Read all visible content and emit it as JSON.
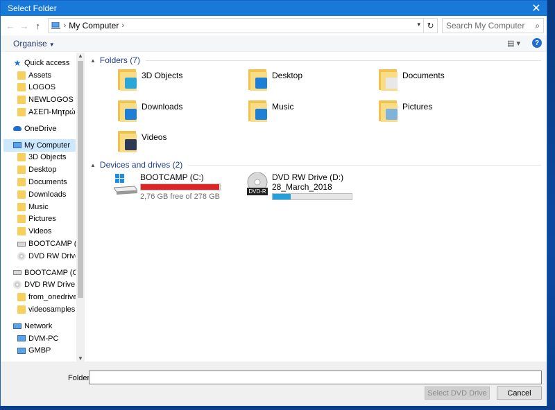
{
  "window": {
    "title": "Select Folder"
  },
  "address": {
    "location": "My Computer",
    "search_placeholder": "Search My Computer"
  },
  "toolbar": {
    "organise": "Organise"
  },
  "sidebar": {
    "items": [
      {
        "label": "Quick access",
        "icon": "star-icon",
        "level": 0
      },
      {
        "label": "Assets",
        "icon": "folder-icon",
        "level": 1
      },
      {
        "label": "LOGOS",
        "icon": "folder-icon",
        "level": 1
      },
      {
        "label": "NEWLOGOS",
        "icon": "folder-icon",
        "level": 1
      },
      {
        "label": "ΑΣΕΠ-Μητρώο_",
        "icon": "folder-icon",
        "level": 1
      },
      {
        "label": "OneDrive",
        "icon": "cloud-icon",
        "level": 0
      },
      {
        "label": "My Computer",
        "icon": "computer-icon",
        "level": 0,
        "selected": true
      },
      {
        "label": "3D Objects",
        "icon": "folder-icon",
        "level": 1
      },
      {
        "label": "Desktop",
        "icon": "folder-icon",
        "level": 1
      },
      {
        "label": "Documents",
        "icon": "folder-icon",
        "level": 1
      },
      {
        "label": "Downloads",
        "icon": "folder-icon",
        "level": 1
      },
      {
        "label": "Music",
        "icon": "folder-icon",
        "level": 1
      },
      {
        "label": "Pictures",
        "icon": "folder-icon",
        "level": 1
      },
      {
        "label": "Videos",
        "icon": "folder-icon",
        "level": 1
      },
      {
        "label": "BOOTCAMP (C:)",
        "icon": "drive-icon",
        "level": 1
      },
      {
        "label": "DVD RW Drive (D",
        "icon": "dvd-icon",
        "level": 1
      },
      {
        "label": "BOOTCAMP (C:)",
        "icon": "drive-icon",
        "level": 0
      },
      {
        "label": "DVD RW Drive (D:",
        "icon": "dvd-icon",
        "level": 0
      },
      {
        "label": "from_onedrive",
        "icon": "folder-icon",
        "level": 1
      },
      {
        "label": "videosamples",
        "icon": "folder-icon",
        "level": 1
      },
      {
        "label": "Network",
        "icon": "network-icon",
        "level": 0
      },
      {
        "label": "DVM-PC",
        "icon": "computer-icon",
        "level": 1
      },
      {
        "label": "GMBP",
        "icon": "computer-icon",
        "level": 1
      }
    ]
  },
  "folders": {
    "heading": "Folders (7)",
    "items": [
      {
        "label": "3D Objects",
        "icon": "3d-objects-folder-icon",
        "badge": "#2aa7d8"
      },
      {
        "label": "Desktop",
        "icon": "desktop-folder-icon",
        "badge": "#1e7fd6"
      },
      {
        "label": "Documents",
        "icon": "documents-folder-icon",
        "badge": "#e8e8e8"
      },
      {
        "label": "Downloads",
        "icon": "downloads-folder-icon",
        "badge": "#1e7fd6"
      },
      {
        "label": "Music",
        "icon": "music-folder-icon",
        "badge": "#1e7fd6"
      },
      {
        "label": "Pictures",
        "icon": "pictures-folder-icon",
        "badge": "#7fb3d9"
      },
      {
        "label": "Videos",
        "icon": "videos-folder-icon",
        "badge": "#2d3a55"
      }
    ]
  },
  "drives": {
    "heading": "Devices and drives (2)",
    "items": [
      {
        "label": "BOOTCAMP (C:)",
        "sub": "2,76 GB free of 278 GB",
        "used_fraction": 0.99,
        "bar_color": "#da2626",
        "icon": "windows-drive-icon"
      },
      {
        "label": "DVD RW Drive (D:)",
        "sub": "28_March_2018",
        "used_fraction": 0.23,
        "bar_color": "#26a0da",
        "icon": "dvd-drive-icon",
        "disc_label": "DVD-R"
      }
    ]
  },
  "footer": {
    "folder_label": "Folder:",
    "folder_value": "",
    "select_button": "Select DVD Drive",
    "cancel_button": "Cancel"
  }
}
